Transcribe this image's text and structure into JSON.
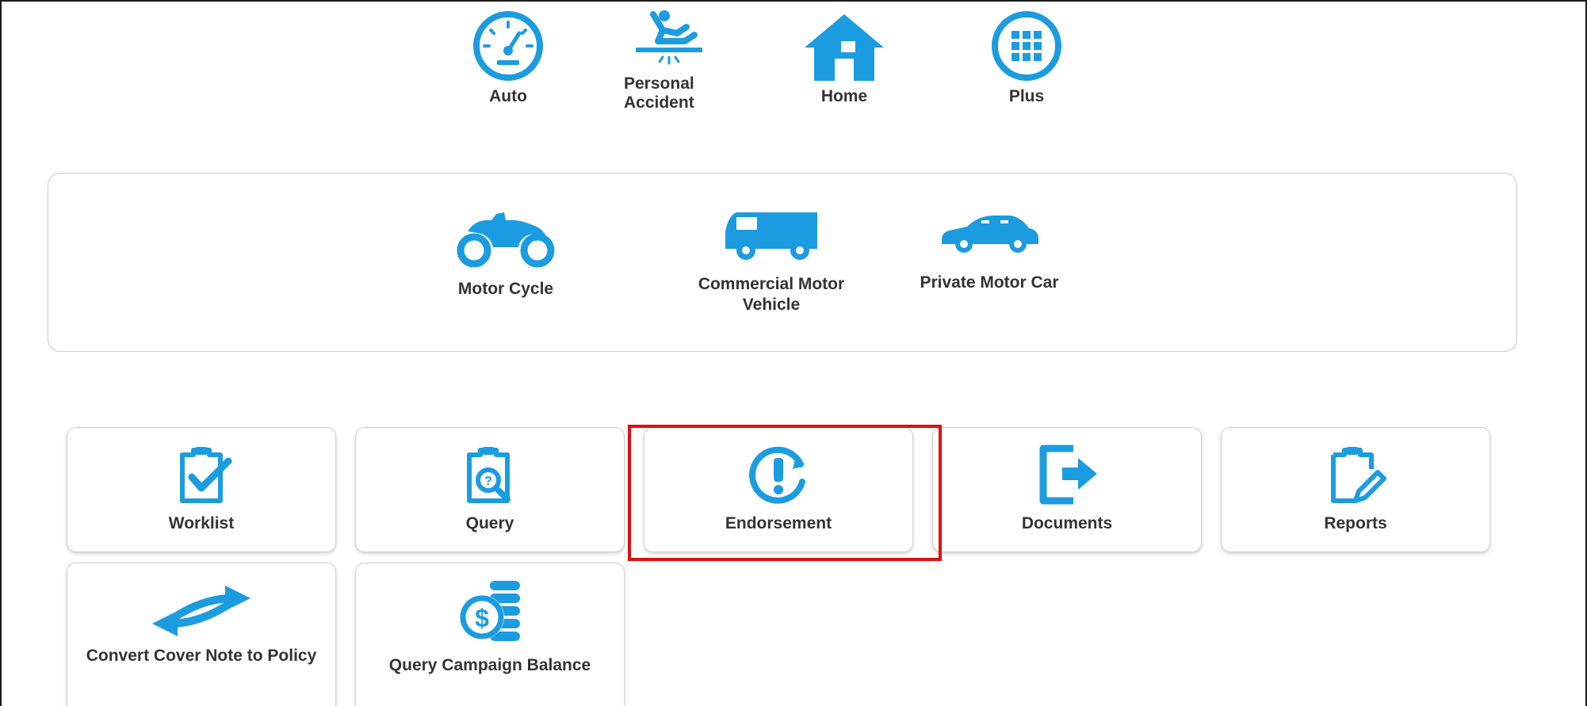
{
  "categories": [
    {
      "label": "Auto",
      "icon": "speedometer-icon"
    },
    {
      "label": "Personal Accident",
      "icon": "falling-person-icon"
    },
    {
      "label": "Home",
      "icon": "house-icon"
    },
    {
      "label": "Plus",
      "icon": "grid-icon"
    }
  ],
  "auto_types": [
    {
      "label": "Motor Cycle",
      "icon": "motorcycle-icon"
    },
    {
      "label": "Commercial Motor Vehicle",
      "icon": "van-icon"
    },
    {
      "label": "Private Motor Car",
      "icon": "car-icon"
    }
  ],
  "tiles": [
    {
      "label": "Worklist",
      "icon": "clipboard-check-icon"
    },
    {
      "label": "Query",
      "icon": "clipboard-search-icon"
    },
    {
      "label": "Endorsement",
      "icon": "exclamation-refresh-icon"
    },
    {
      "label": "Documents",
      "icon": "exit-door-icon"
    },
    {
      "label": "Reports",
      "icon": "clipboard-pencil-icon"
    },
    {
      "label": "Convert Cover Note to Policy",
      "icon": "swap-arrows-icon"
    },
    {
      "label": "Query Campaign Balance",
      "icon": "dollar-coins-icon"
    }
  ],
  "colors": {
    "icon_blue": "#1c9ce0",
    "highlight": "#e01010",
    "text": "#333333"
  }
}
